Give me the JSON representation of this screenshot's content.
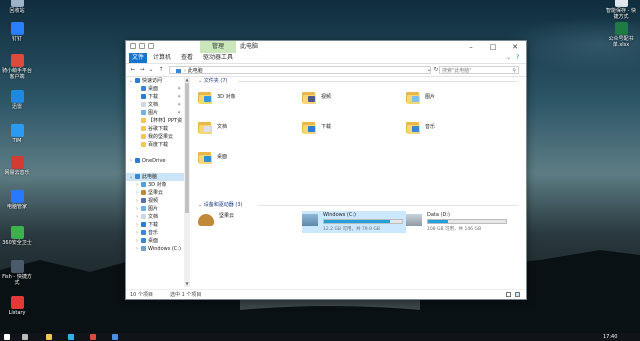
{
  "desktop": {
    "icons_left": [
      {
        "label": "回收站",
        "icon": "recycle-bin-icon",
        "color": "#9fb3c8"
      },
      {
        "label": "钉钉",
        "icon": "dingtalk-icon",
        "color": "#2a7fff"
      },
      {
        "label": "骑小萌手平台\n客户端",
        "icon": "app-icon",
        "color": "#e04a3a"
      },
      {
        "label": "迅雷",
        "icon": "xunlei-icon",
        "color": "#1e88e5"
      },
      {
        "label": "TIM",
        "icon": "tim-icon",
        "color": "#2b9af3"
      },
      {
        "label": "网易云音乐",
        "icon": "music-icon",
        "color": "#d43c33"
      },
      {
        "label": "电脑管家",
        "icon": "pc-manager-icon",
        "color": "#2979ff"
      },
      {
        "label": "360安全卫士",
        "icon": "360-icon",
        "color": "#3bb34a"
      },
      {
        "label": "Fish - 快捷方\n式",
        "icon": "fish-icon",
        "color": "#4b5b6b"
      },
      {
        "label": "Listary",
        "icon": "listary-icon",
        "color": "#e53935"
      }
    ],
    "icons_right": [
      {
        "label": "智能保存 - 快\n捷方式",
        "icon": "shortcut-icon",
        "color": "#e0e6ee"
      },
      {
        "label": "公众号配书\n单.xlsx",
        "icon": "excel-icon",
        "color": "#1f7a44"
      }
    ]
  },
  "window": {
    "context_tab": "管理",
    "title": "此电脑",
    "ribbon_tabs": [
      "文件",
      "计算机",
      "查看",
      "驱动器工具"
    ],
    "breadcrumb": "此电脑",
    "search_placeholder": "搜索\"此电脑\""
  },
  "sidebar": {
    "items": [
      {
        "label": "快速访问",
        "chev": "expanded",
        "icon": "star-icon",
        "color": "#2b7cd3",
        "indent": 0,
        "pin": false
      },
      {
        "label": "桌面",
        "chev": "",
        "icon": "desktop-folder-icon",
        "color": "#3a86d4",
        "indent": 1,
        "pin": true
      },
      {
        "label": "下载",
        "chev": "",
        "icon": "download-icon",
        "color": "#2b7cd3",
        "indent": 1,
        "pin": true
      },
      {
        "label": "文档",
        "chev": "",
        "icon": "document-icon",
        "color": "#cfd8e2",
        "indent": 1,
        "pin": true
      },
      {
        "label": "图片",
        "chev": "",
        "icon": "picture-icon",
        "color": "#6fb1e6",
        "indent": 1,
        "pin": true
      },
      {
        "label": "【杯杯】PPT资",
        "chev": "",
        "icon": "folder-icon",
        "color": "#f2c94c",
        "indent": 1,
        "pin": false
      },
      {
        "label": "谷歌下载",
        "chev": "",
        "icon": "folder-icon",
        "color": "#f2c94c",
        "indent": 1,
        "pin": false
      },
      {
        "label": "我的坚果云",
        "chev": "",
        "icon": "folder-icon",
        "color": "#f2c94c",
        "indent": 1,
        "pin": false
      },
      {
        "label": "百度下载",
        "chev": "",
        "icon": "folder-icon",
        "color": "#f2c94c",
        "indent": 1,
        "pin": false
      },
      {
        "label": "",
        "chev": "",
        "icon": "",
        "color": "",
        "indent": 0,
        "pin": false
      },
      {
        "label": "OneDrive",
        "chev": "collapsed",
        "icon": "onedrive-icon",
        "color": "#2b7cd3",
        "indent": 0,
        "pin": false
      },
      {
        "label": "",
        "chev": "",
        "icon": "",
        "color": "",
        "indent": 0,
        "pin": false
      },
      {
        "label": "此电脑",
        "chev": "expanded",
        "icon": "this-pc-icon",
        "color": "#3a86d4",
        "indent": 0,
        "pin": false,
        "selected": true
      },
      {
        "label": "3D 对象",
        "chev": "collapsed",
        "icon": "3d-objects-icon",
        "color": "#4aa3df",
        "indent": 1,
        "pin": false
      },
      {
        "label": "坚果云",
        "chev": "collapsed",
        "icon": "nutstore-icon",
        "color": "#c08a3a",
        "indent": 1,
        "pin": false
      },
      {
        "label": "视频",
        "chev": "collapsed",
        "icon": "video-icon",
        "color": "#5b6fa8",
        "indent": 1,
        "pin": false
      },
      {
        "label": "图片",
        "chev": "collapsed",
        "icon": "picture-icon",
        "color": "#6fb1e6",
        "indent": 1,
        "pin": false
      },
      {
        "label": "文档",
        "chev": "collapsed",
        "icon": "document-icon",
        "color": "#cfd8e2",
        "indent": 1,
        "pin": false
      },
      {
        "label": "下载",
        "chev": "collapsed",
        "icon": "download-icon",
        "color": "#2b7cd3",
        "indent": 1,
        "pin": false
      },
      {
        "label": "音乐",
        "chev": "collapsed",
        "icon": "music-folder-icon",
        "color": "#3a86d4",
        "indent": 1,
        "pin": false
      },
      {
        "label": "桌面",
        "chev": "collapsed",
        "icon": "desktop-folder-icon",
        "color": "#3a86d4",
        "indent": 1,
        "pin": false
      },
      {
        "label": "Windows (C:)",
        "chev": "collapsed",
        "icon": "drive-icon",
        "color": "#6fa0c8",
        "indent": 1,
        "pin": false
      }
    ]
  },
  "content": {
    "folders_header": "文件夹 (7)",
    "folders": [
      {
        "label": "3D 对象",
        "badge": "#2f9ae0",
        "icon": "3d-objects-icon"
      },
      {
        "label": "视频",
        "badge": "#4a5a8a",
        "icon": "video-icon"
      },
      {
        "label": "图片",
        "badge": "#7cc0f0",
        "icon": "picture-icon"
      },
      {
        "label": "文档",
        "badge": "#d9e2ea",
        "icon": "document-icon"
      },
      {
        "label": "下载",
        "badge": "#2b7cd3",
        "icon": "download-icon"
      },
      {
        "label": "音乐",
        "badge": "#3a86d4",
        "icon": "music-folder-icon"
      },
      {
        "label": "桌面",
        "badge": "#2e8fd6",
        "icon": "desktop-folder-icon"
      }
    ],
    "devices_header": "设备和驱动器 (3)",
    "devices": [
      {
        "name": "坚果云",
        "icon": "nutstore-icon",
        "has_bar": false
      },
      {
        "name": "Windows (C:)",
        "free": "12.2 GB 可用，共 79.9 GB",
        "used_fraction": 0.85,
        "icon": "windows-drive-icon",
        "has_bar": true,
        "selected": true
      },
      {
        "name": "Data (D:)",
        "free": "108 GB 可用，共 146 GB",
        "used_fraction": 0.26,
        "icon": "drive-icon",
        "has_bar": true
      }
    ]
  },
  "status": {
    "count": "10 个项目",
    "selected": "选中 1 个项目"
  },
  "taskbar": {
    "time": "17:40",
    "accent": "#26a0da"
  }
}
